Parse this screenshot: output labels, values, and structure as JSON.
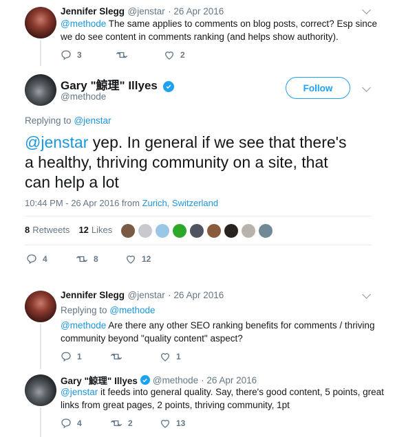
{
  "tweet1": {
    "name": "Jennifer Slegg",
    "handle": "@jenstar",
    "date": "· 26 Apr 2016",
    "mention": "@methode",
    "text_line1": "The same applies to comments on blog posts, correct?  Esp since",
    "text_line2": "we do see content in comments ranking (and helps show authority).",
    "replies": "3",
    "retweets": "",
    "likes": "2"
  },
  "main": {
    "name": "Gary \"鯨理\" Illyes",
    "handle": "@methode",
    "follow_label": "Follow",
    "replying_prefix": "Replying to",
    "replying_to": "@jenstar",
    "mention": "@jenstar",
    "text_line1": "yep. In general if we see that there's",
    "text_line2": "a healthy, thriving community on a site, that",
    "text_line3": "can help a lot",
    "timestamp": "10:44 PM - 26 Apr 2016 from",
    "location": "Zurich, Switzerland",
    "retweet_count": "8",
    "retweet_label": "Retweets",
    "like_count": "12",
    "like_label": "Likes",
    "replies": "4",
    "retweets": "8",
    "likes": "12"
  },
  "tweet3": {
    "name": "Jennifer Slegg",
    "handle": "@jenstar",
    "date": "· 26 Apr 2016",
    "replying_prefix": "Replying to",
    "replying_to": "@methode",
    "mention": "@methode",
    "text_line1": "Are there any other SEO ranking benefits for comments / thriving",
    "text_line2": "community beyond \"quality content\" aspect?",
    "replies": "1",
    "retweets": "",
    "likes": "1"
  },
  "tweet4": {
    "name": "Gary \"鯨理\" Illyes",
    "handle": "@methode",
    "date": "· 26 Apr 2016",
    "mention": "@jenstar",
    "text_line1": "it feeds into general quality. Say, there's good content, 5 points, great",
    "text_line2": "links from great pages, 2 points, thriving community, 1pt",
    "replies": "4",
    "retweets": "2",
    "likes": "13"
  },
  "colors": {
    "link": "#1b95e0",
    "muted": "#657786",
    "follow": "#1da1f2",
    "retweet_active": "#17bf63"
  }
}
